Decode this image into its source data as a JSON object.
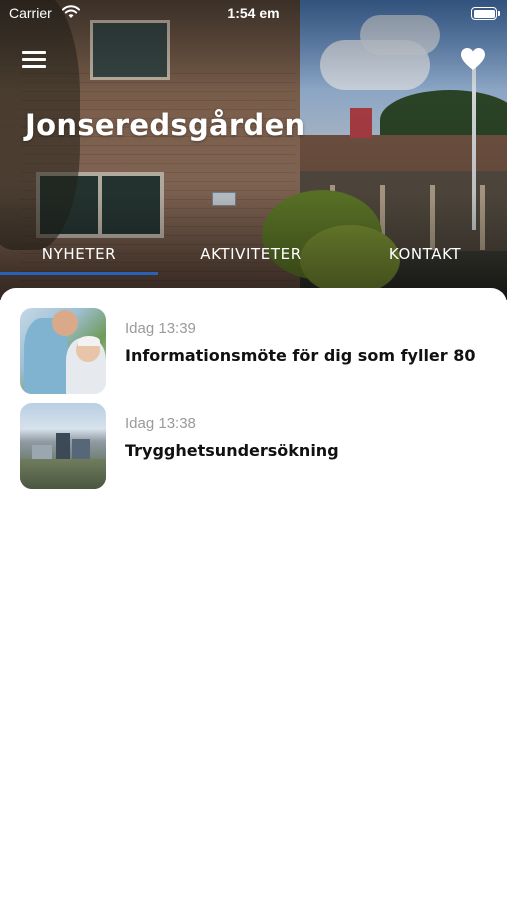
{
  "status_bar": {
    "carrier": "Carrier",
    "time": "1:54 em"
  },
  "header": {
    "title": "Jonseredsgården",
    "menu_icon": "hamburger-menu-icon",
    "favorite_icon": "heart-icon"
  },
  "tabs": [
    {
      "label": "NYHETER",
      "selected": true
    },
    {
      "label": "AKTIVITETER",
      "selected": false
    },
    {
      "label": "KONTAKT",
      "selected": false
    }
  ],
  "news": [
    {
      "date": "Idag 13:39",
      "title": "Informationsmöte för dig som fyller 80",
      "image": "nurse-and-elderly-photo"
    },
    {
      "date": "Idag 13:38",
      "title": "Trygghetsundersökning",
      "image": "city-view-photo"
    }
  ],
  "colors": {
    "accent": "#2a62b9",
    "title_text": "#111111",
    "date_text": "#9a9a9a"
  }
}
